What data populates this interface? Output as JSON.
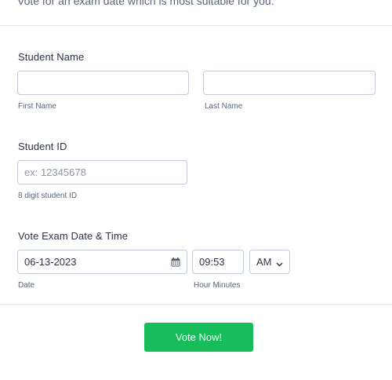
{
  "intro": {
    "text": "Vote for an exam date which is most suitable for you."
  },
  "student_name": {
    "label": "Student Name",
    "first": {
      "value": "",
      "sublabel": "First Name"
    },
    "last": {
      "value": "",
      "sublabel": "Last Name"
    }
  },
  "student_id": {
    "label": "Student ID",
    "placeholder": "ex: 12345678",
    "value": "",
    "sublabel": "8 digit student ID"
  },
  "exam_datetime": {
    "label": "Vote Exam Date & Time",
    "date": {
      "value": "06-13-2023",
      "sublabel": "Date",
      "icon": "calendar-icon"
    },
    "time": {
      "value": "09:53",
      "sublabel": "Hour Minutes"
    },
    "ampm": {
      "value": "AM",
      "icon": "chevron-down-icon"
    }
  },
  "submit": {
    "label": "Vote Now!",
    "color": "#18bd5b"
  },
  "colors": {
    "border": "#c3cad8",
    "divider": "#e3e5ea",
    "text": "#2c3345",
    "muted": "#57647e"
  }
}
